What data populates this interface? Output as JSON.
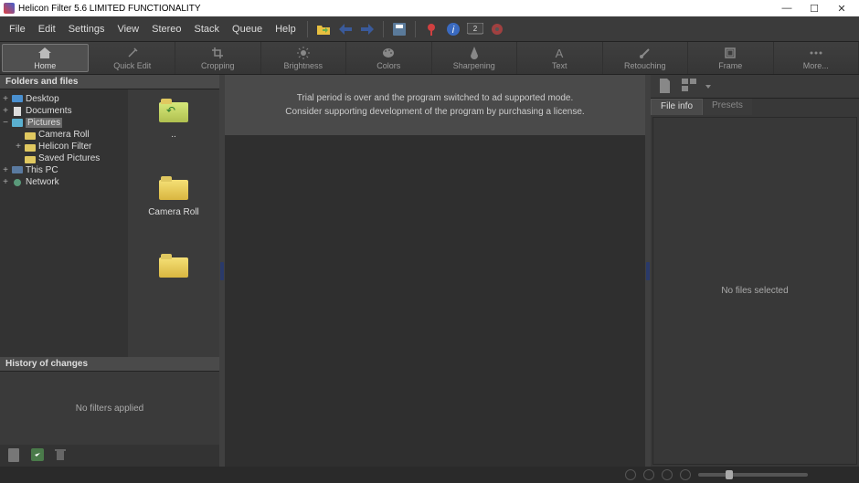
{
  "window": {
    "title": "Helicon Filter 5.6 LIMITED FUNCTIONALITY",
    "min": "—",
    "max": "☐",
    "close": "✕"
  },
  "menu": {
    "file": "File",
    "edit": "Edit",
    "settings": "Settings",
    "view": "View",
    "stereo": "Stereo",
    "stack": "Stack",
    "queue": "Queue",
    "help": "Help"
  },
  "ribbon": {
    "home": "Home",
    "quick": "Quick Edit",
    "crop": "Cropping",
    "bright": "Brightness",
    "colors": "Colors",
    "sharp": "Sharpening",
    "text": "Text",
    "retouch": "Retouching",
    "frame": "Frame",
    "more": "More..."
  },
  "left": {
    "folders_title": "Folders and files",
    "tree": {
      "desktop": "Desktop",
      "documents": "Documents",
      "pictures": "Pictures",
      "camera": "Camera Roll",
      "helicon": "Helicon Filter",
      "saved": "Saved Pictures",
      "thispc": "This PC",
      "network": "Network"
    },
    "thumbs": {
      "up": "..",
      "camera": "Camera Roll"
    },
    "history_title": "History of changes",
    "history_empty": "No filters applied"
  },
  "center": {
    "trial1": "Trial period is over and the program switched to ad supported mode.",
    "trial2": "Consider supporting development of the program by purchasing a license."
  },
  "right": {
    "tab_info": "File info",
    "tab_presets": "Presets",
    "no_files": "No files selected"
  }
}
